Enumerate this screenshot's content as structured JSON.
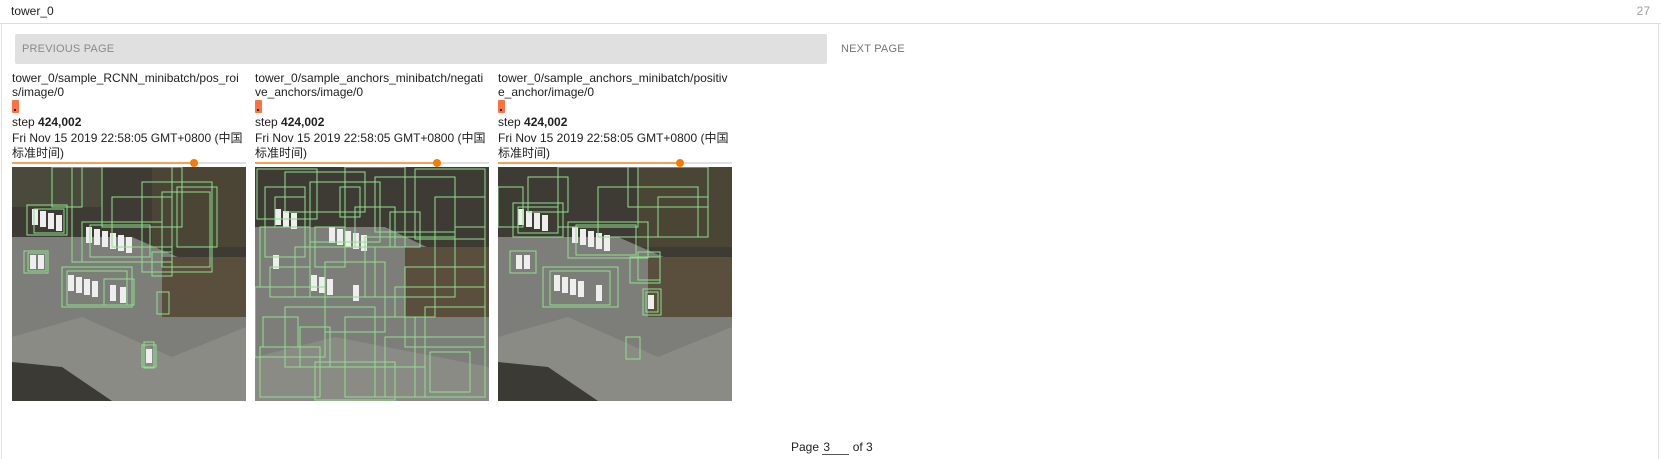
{
  "header": {
    "title": "tower_0",
    "count": "27"
  },
  "pagination": {
    "prev_label": "PREVIOUS PAGE",
    "next_label": "NEXT PAGE",
    "page_prefix": "Page",
    "current_page": "3",
    "page_suffix": "of 3"
  },
  "cards": [
    {
      "title": "tower_0/sample_RCNN_minibatch/pos_rois/image/0",
      "step_label": "step",
      "step": "424,002",
      "time": "Fri Nov 15 2019 22:58:05 GMT+0800 (中国标准时间)",
      "image_alt": "aerial parking lot with green boxes"
    },
    {
      "title": "tower_0/sample_anchors_minibatch/negative_anchors/image/0",
      "step_label": "step",
      "step": "424,002",
      "time": "Fri Nov 15 2019 22:58:05 GMT+0800 (中国标准时间)",
      "image_alt": "aerial parking lot with many green boxes"
    },
    {
      "title": "tower_0/sample_anchors_minibatch/positive_anchor/image/0",
      "step_label": "step",
      "step": "424,002",
      "time": "Fri Nov 15 2019 22:58:05 GMT+0800 (中国标准时间)",
      "image_alt": "aerial parking lot with green boxes"
    }
  ],
  "colors": {
    "chip": "#ff7043",
    "slider": "#f57c00",
    "box": "#7ddc7d"
  }
}
